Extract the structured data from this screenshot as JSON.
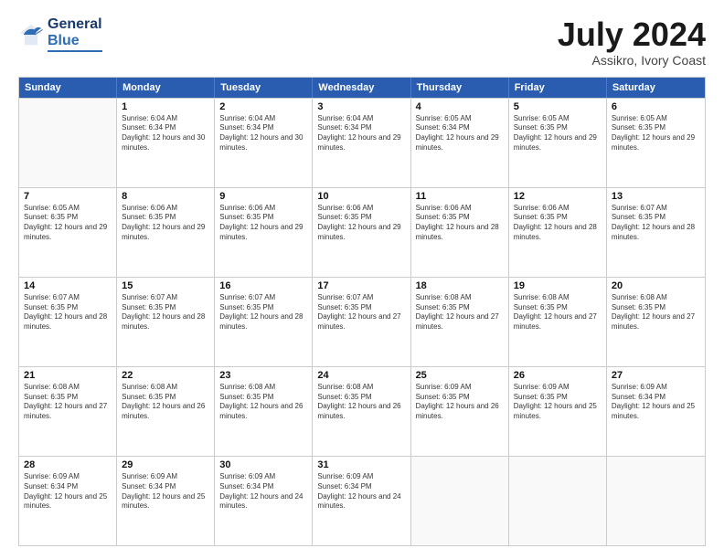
{
  "header": {
    "logo_general": "General",
    "logo_blue": "Blue",
    "month_title": "July 2024",
    "subtitle": "Assikro, Ivory Coast"
  },
  "calendar": {
    "days_of_week": [
      "Sunday",
      "Monday",
      "Tuesday",
      "Wednesday",
      "Thursday",
      "Friday",
      "Saturday"
    ],
    "rows": [
      [
        {
          "day": "",
          "sunrise": "",
          "sunset": "",
          "daylight": "",
          "empty": true
        },
        {
          "day": "1",
          "sunrise": "Sunrise: 6:04 AM",
          "sunset": "Sunset: 6:34 PM",
          "daylight": "Daylight: 12 hours and 30 minutes."
        },
        {
          "day": "2",
          "sunrise": "Sunrise: 6:04 AM",
          "sunset": "Sunset: 6:34 PM",
          "daylight": "Daylight: 12 hours and 30 minutes."
        },
        {
          "day": "3",
          "sunrise": "Sunrise: 6:04 AM",
          "sunset": "Sunset: 6:34 PM",
          "daylight": "Daylight: 12 hours and 29 minutes."
        },
        {
          "day": "4",
          "sunrise": "Sunrise: 6:05 AM",
          "sunset": "Sunset: 6:34 PM",
          "daylight": "Daylight: 12 hours and 29 minutes."
        },
        {
          "day": "5",
          "sunrise": "Sunrise: 6:05 AM",
          "sunset": "Sunset: 6:35 PM",
          "daylight": "Daylight: 12 hours and 29 minutes."
        },
        {
          "day": "6",
          "sunrise": "Sunrise: 6:05 AM",
          "sunset": "Sunset: 6:35 PM",
          "daylight": "Daylight: 12 hours and 29 minutes."
        }
      ],
      [
        {
          "day": "7",
          "sunrise": "Sunrise: 6:05 AM",
          "sunset": "Sunset: 6:35 PM",
          "daylight": "Daylight: 12 hours and 29 minutes."
        },
        {
          "day": "8",
          "sunrise": "Sunrise: 6:06 AM",
          "sunset": "Sunset: 6:35 PM",
          "daylight": "Daylight: 12 hours and 29 minutes."
        },
        {
          "day": "9",
          "sunrise": "Sunrise: 6:06 AM",
          "sunset": "Sunset: 6:35 PM",
          "daylight": "Daylight: 12 hours and 29 minutes."
        },
        {
          "day": "10",
          "sunrise": "Sunrise: 6:06 AM",
          "sunset": "Sunset: 6:35 PM",
          "daylight": "Daylight: 12 hours and 29 minutes."
        },
        {
          "day": "11",
          "sunrise": "Sunrise: 6:06 AM",
          "sunset": "Sunset: 6:35 PM",
          "daylight": "Daylight: 12 hours and 28 minutes."
        },
        {
          "day": "12",
          "sunrise": "Sunrise: 6:06 AM",
          "sunset": "Sunset: 6:35 PM",
          "daylight": "Daylight: 12 hours and 28 minutes."
        },
        {
          "day": "13",
          "sunrise": "Sunrise: 6:07 AM",
          "sunset": "Sunset: 6:35 PM",
          "daylight": "Daylight: 12 hours and 28 minutes."
        }
      ],
      [
        {
          "day": "14",
          "sunrise": "Sunrise: 6:07 AM",
          "sunset": "Sunset: 6:35 PM",
          "daylight": "Daylight: 12 hours and 28 minutes."
        },
        {
          "day": "15",
          "sunrise": "Sunrise: 6:07 AM",
          "sunset": "Sunset: 6:35 PM",
          "daylight": "Daylight: 12 hours and 28 minutes."
        },
        {
          "day": "16",
          "sunrise": "Sunrise: 6:07 AM",
          "sunset": "Sunset: 6:35 PM",
          "daylight": "Daylight: 12 hours and 28 minutes."
        },
        {
          "day": "17",
          "sunrise": "Sunrise: 6:07 AM",
          "sunset": "Sunset: 6:35 PM",
          "daylight": "Daylight: 12 hours and 27 minutes."
        },
        {
          "day": "18",
          "sunrise": "Sunrise: 6:08 AM",
          "sunset": "Sunset: 6:35 PM",
          "daylight": "Daylight: 12 hours and 27 minutes."
        },
        {
          "day": "19",
          "sunrise": "Sunrise: 6:08 AM",
          "sunset": "Sunset: 6:35 PM",
          "daylight": "Daylight: 12 hours and 27 minutes."
        },
        {
          "day": "20",
          "sunrise": "Sunrise: 6:08 AM",
          "sunset": "Sunset: 6:35 PM",
          "daylight": "Daylight: 12 hours and 27 minutes."
        }
      ],
      [
        {
          "day": "21",
          "sunrise": "Sunrise: 6:08 AM",
          "sunset": "Sunset: 6:35 PM",
          "daylight": "Daylight: 12 hours and 27 minutes."
        },
        {
          "day": "22",
          "sunrise": "Sunrise: 6:08 AM",
          "sunset": "Sunset: 6:35 PM",
          "daylight": "Daylight: 12 hours and 26 minutes."
        },
        {
          "day": "23",
          "sunrise": "Sunrise: 6:08 AM",
          "sunset": "Sunset: 6:35 PM",
          "daylight": "Daylight: 12 hours and 26 minutes."
        },
        {
          "day": "24",
          "sunrise": "Sunrise: 6:08 AM",
          "sunset": "Sunset: 6:35 PM",
          "daylight": "Daylight: 12 hours and 26 minutes."
        },
        {
          "day": "25",
          "sunrise": "Sunrise: 6:09 AM",
          "sunset": "Sunset: 6:35 PM",
          "daylight": "Daylight: 12 hours and 26 minutes."
        },
        {
          "day": "26",
          "sunrise": "Sunrise: 6:09 AM",
          "sunset": "Sunset: 6:35 PM",
          "daylight": "Daylight: 12 hours and 25 minutes."
        },
        {
          "day": "27",
          "sunrise": "Sunrise: 6:09 AM",
          "sunset": "Sunset: 6:34 PM",
          "daylight": "Daylight: 12 hours and 25 minutes."
        }
      ],
      [
        {
          "day": "28",
          "sunrise": "Sunrise: 6:09 AM",
          "sunset": "Sunset: 6:34 PM",
          "daylight": "Daylight: 12 hours and 25 minutes."
        },
        {
          "day": "29",
          "sunrise": "Sunrise: 6:09 AM",
          "sunset": "Sunset: 6:34 PM",
          "daylight": "Daylight: 12 hours and 25 minutes."
        },
        {
          "day": "30",
          "sunrise": "Sunrise: 6:09 AM",
          "sunset": "Sunset: 6:34 PM",
          "daylight": "Daylight: 12 hours and 24 minutes."
        },
        {
          "day": "31",
          "sunrise": "Sunrise: 6:09 AM",
          "sunset": "Sunset: 6:34 PM",
          "daylight": "Daylight: 12 hours and 24 minutes."
        },
        {
          "day": "",
          "sunrise": "",
          "sunset": "",
          "daylight": "",
          "empty": true
        },
        {
          "day": "",
          "sunrise": "",
          "sunset": "",
          "daylight": "",
          "empty": true
        },
        {
          "day": "",
          "sunrise": "",
          "sunset": "",
          "daylight": "",
          "empty": true
        }
      ]
    ]
  }
}
